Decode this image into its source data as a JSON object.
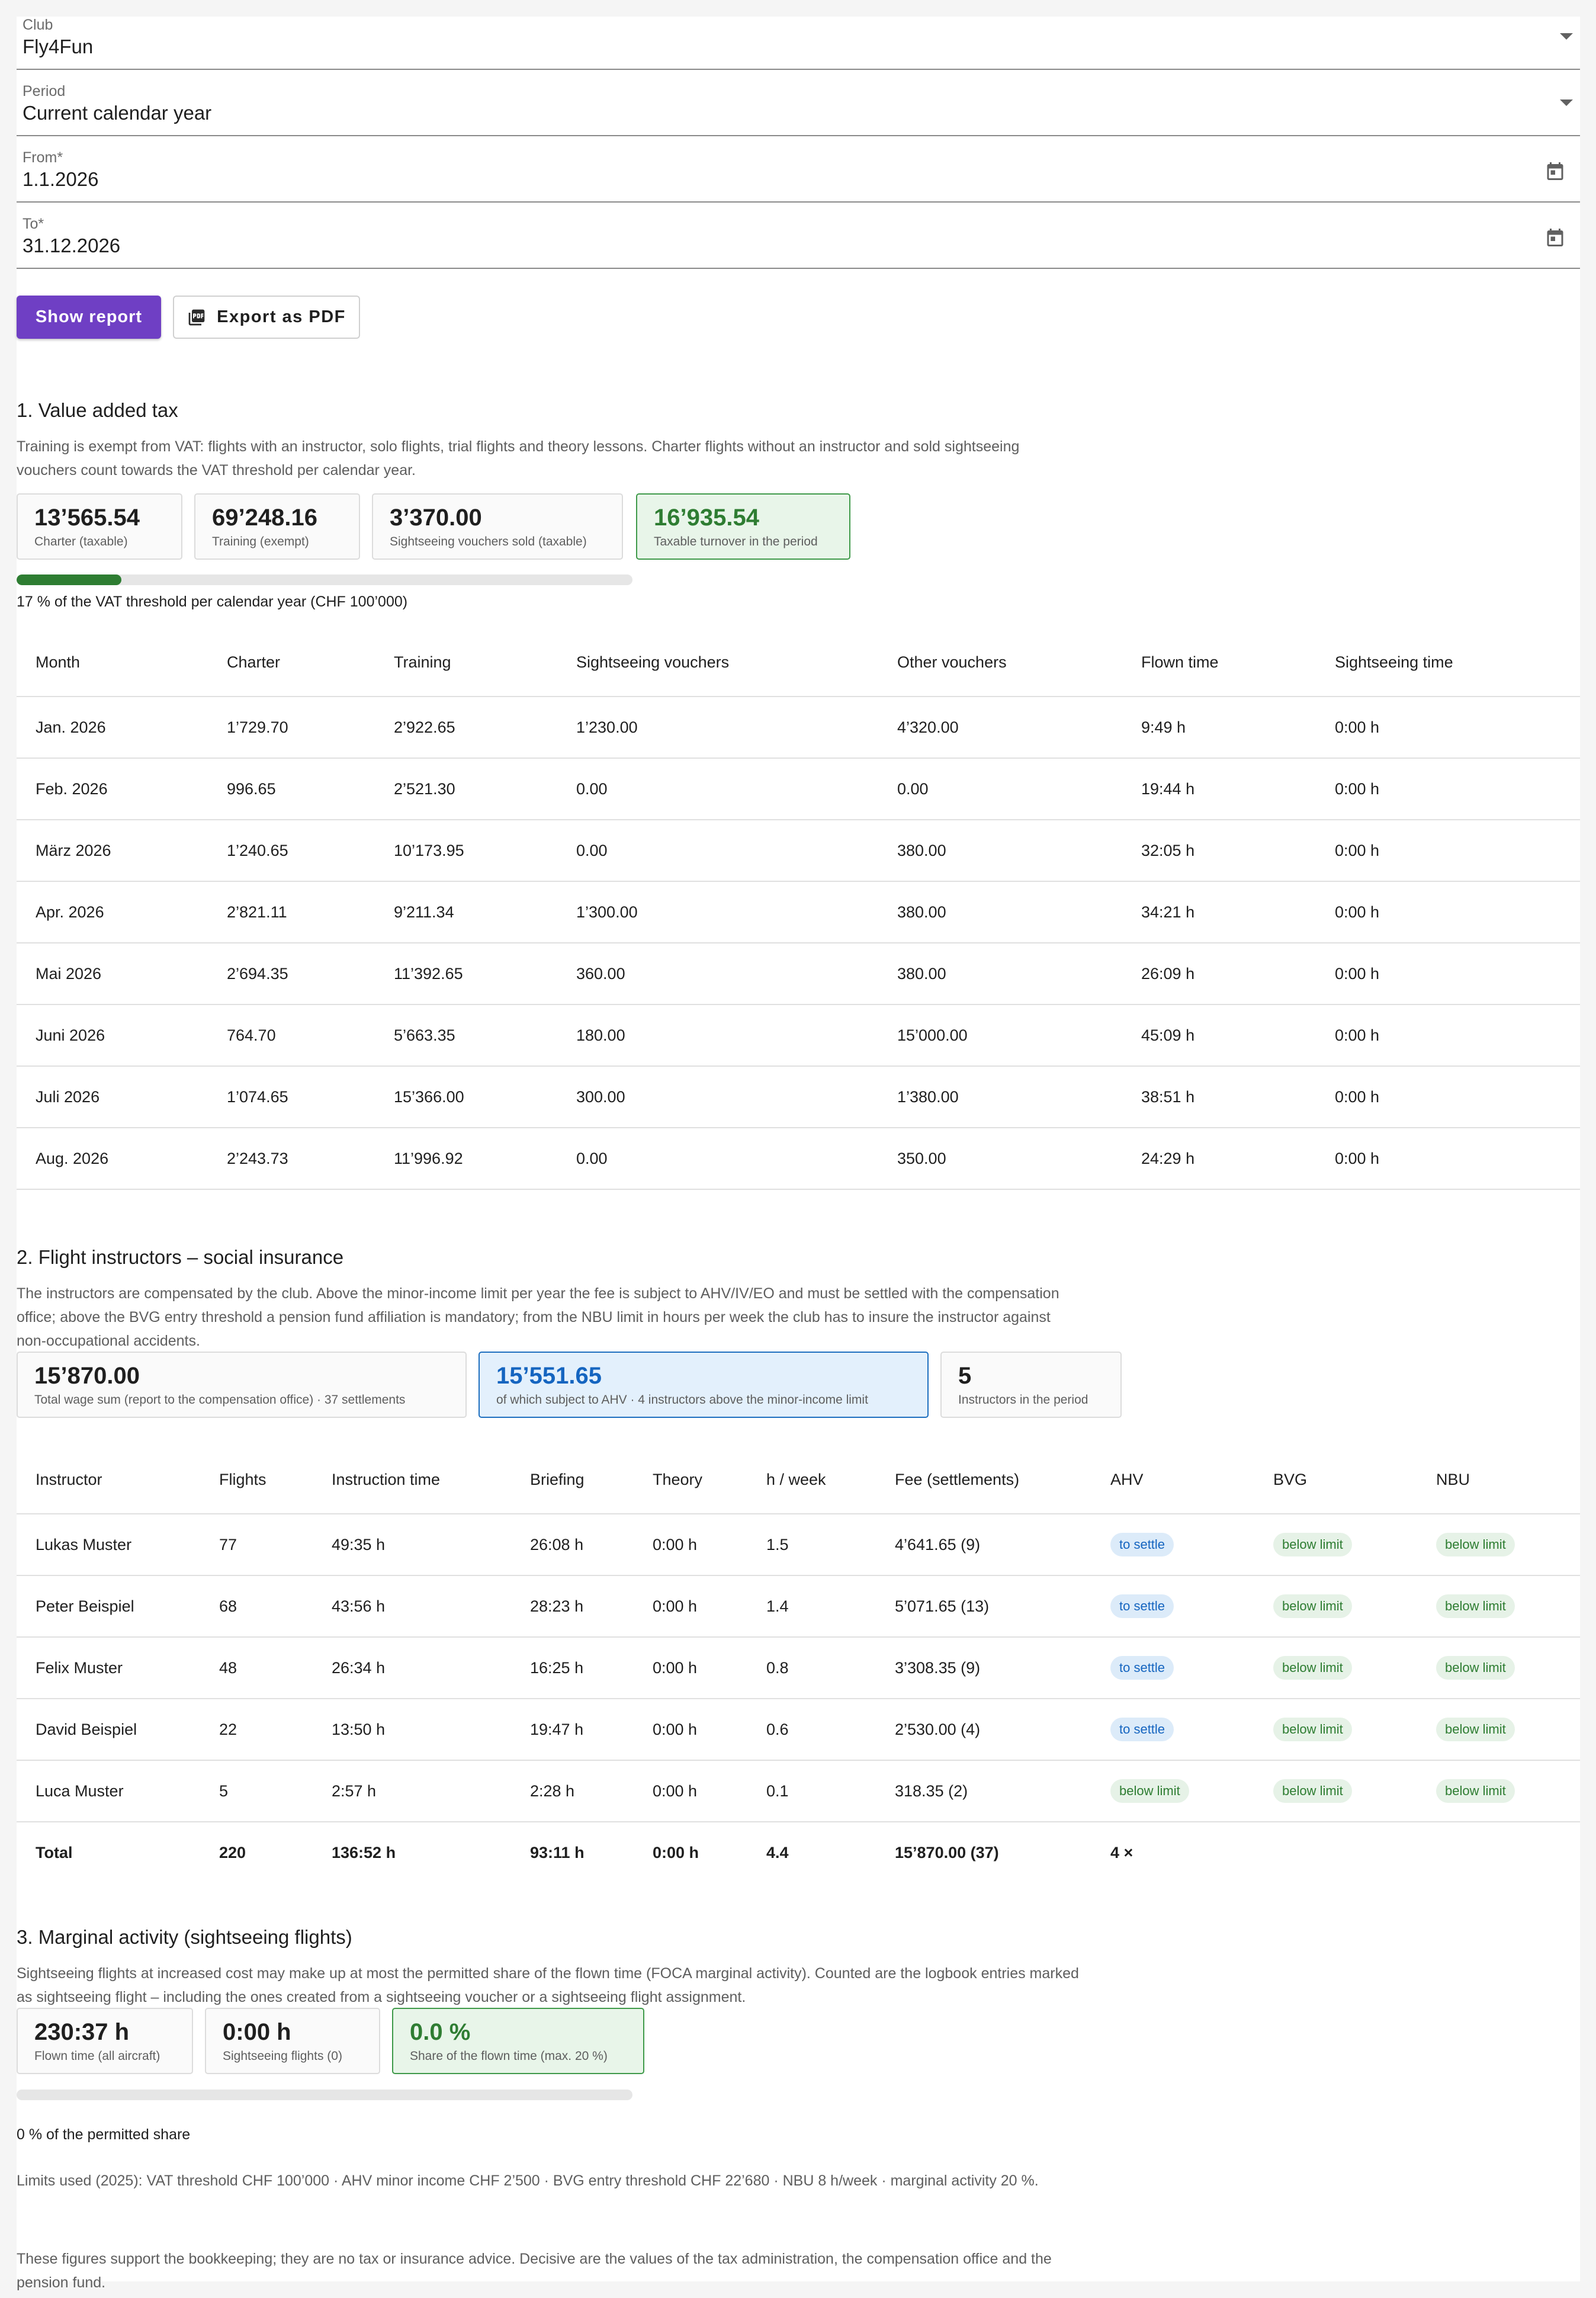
{
  "form": {
    "club": {
      "label": "Club",
      "value": "Fly4Fun"
    },
    "period": {
      "label": "Period",
      "value": "Current calendar year"
    },
    "from": {
      "label": "From*",
      "value": "1.1.2026"
    },
    "to": {
      "label": "To*",
      "value": "31.12.2026"
    },
    "show_report_label": "Show report",
    "export_pdf_label": "Export as PDF"
  },
  "vat": {
    "title": "1. Value added tax",
    "description": "Training is exempt from VAT: flights with an instructor, solo flights, trial flights and theory lessons. Charter flights without an instructor and sold sightseeing vouchers count towards the VAT threshold per calendar year.",
    "cards": [
      {
        "value": "13’565.54",
        "label": "Charter (taxable)"
      },
      {
        "value": "69’248.16",
        "label": "Training (exempt)"
      },
      {
        "value": "3’370.00",
        "label": "Sightseeing vouchers sold (taxable)"
      },
      {
        "value": "16’935.54",
        "label": "Taxable turnover in the period"
      }
    ],
    "progress_percent": 17,
    "progress_text": "17 % of the VAT threshold per calendar year (CHF 100’000)",
    "columns": [
      "Month",
      "Charter",
      "Training",
      "Sightseeing vouchers",
      "Other vouchers",
      "Flown time",
      "Sightseeing time"
    ],
    "rows": [
      [
        "Jan. 2026",
        "1’729.70",
        "2’922.65",
        "1’230.00",
        "4’320.00",
        "9:49 h",
        "0:00 h"
      ],
      [
        "Feb. 2026",
        "996.65",
        "2’521.30",
        "0.00",
        "0.00",
        "19:44 h",
        "0:00 h"
      ],
      [
        "März 2026",
        "1’240.65",
        "10’173.95",
        "0.00",
        "380.00",
        "32:05 h",
        "0:00 h"
      ],
      [
        "Apr. 2026",
        "2’821.11",
        "9’211.34",
        "1’300.00",
        "380.00",
        "34:21 h",
        "0:00 h"
      ],
      [
        "Mai 2026",
        "2’694.35",
        "11’392.65",
        "360.00",
        "380.00",
        "26:09 h",
        "0:00 h"
      ],
      [
        "Juni 2026",
        "764.70",
        "5’663.35",
        "180.00",
        "15’000.00",
        "45:09 h",
        "0:00 h"
      ],
      [
        "Juli 2026",
        "1’074.65",
        "15’366.00",
        "300.00",
        "1’380.00",
        "38:51 h",
        "0:00 h"
      ],
      [
        "Aug. 2026",
        "2’243.73",
        "11’996.92",
        "0.00",
        "350.00",
        "24:29 h",
        "0:00 h"
      ]
    ]
  },
  "instructors": {
    "title": "2. Flight instructors – social insurance",
    "description": "The instructors are compensated by the club. Above the minor-income limit per year the fee is subject to AHV/IV/EO and must be settled with the compensation office; above the BVG entry threshold a pension fund affiliation is mandatory; from the NBU limit in hours per week the club has to insure the instructor against non-occupational accidents.",
    "cards": [
      {
        "value": "15’870.00",
        "label": "Total wage sum (report to the compensation office) · 37 settlements"
      },
      {
        "value": "15’551.65",
        "label": "of which subject to AHV · 4 instructors above the minor-income limit"
      },
      {
        "value": "5",
        "label": "Instructors in the period"
      }
    ],
    "columns": [
      "Instructor",
      "Flights",
      "Instruction time",
      "Briefing",
      "Theory",
      "h / week",
      "Fee (settlements)",
      "AHV",
      "BVG",
      "NBU"
    ],
    "rows": [
      {
        "name": "Lukas Muster",
        "flights": "77",
        "instruction": "49:35 h",
        "briefing": "26:08 h",
        "theory": "0:00 h",
        "hweek": "1.5",
        "fee": "4’641.65 (9)",
        "ahv": "to settle",
        "bvg": "below limit",
        "nbu": "below limit"
      },
      {
        "name": "Peter Beispiel",
        "flights": "68",
        "instruction": "43:56 h",
        "briefing": "28:23 h",
        "theory": "0:00 h",
        "hweek": "1.4",
        "fee": "5’071.65 (13)",
        "ahv": "to settle",
        "bvg": "below limit",
        "nbu": "below limit"
      },
      {
        "name": "Felix Muster",
        "flights": "48",
        "instruction": "26:34 h",
        "briefing": "16:25 h",
        "theory": "0:00 h",
        "hweek": "0.8",
        "fee": "3’308.35 (9)",
        "ahv": "to settle",
        "bvg": "below limit",
        "nbu": "below limit"
      },
      {
        "name": "David Beispiel",
        "flights": "22",
        "instruction": "13:50 h",
        "briefing": "19:47 h",
        "theory": "0:00 h",
        "hweek": "0.6",
        "fee": "2’530.00 (4)",
        "ahv": "to settle",
        "bvg": "below limit",
        "nbu": "below limit"
      },
      {
        "name": "Luca Muster",
        "flights": "5",
        "instruction": "2:57 h",
        "briefing": "2:28 h",
        "theory": "0:00 h",
        "hweek": "0.1",
        "fee": "318.35 (2)",
        "ahv": "below limit",
        "bvg": "below limit",
        "nbu": "below limit"
      }
    ],
    "total": {
      "name": "Total",
      "flights": "220",
      "instruction": "136:52 h",
      "briefing": "93:11 h",
      "theory": "0:00 h",
      "hweek": "4.4",
      "fee": "15’870.00 (37)",
      "ahv": "4 ×"
    }
  },
  "marginal": {
    "title": "3. Marginal activity (sightseeing flights)",
    "description": "Sightseeing flights at increased cost may make up at most the permitted share of the flown time (FOCA marginal activity). Counted are the logbook entries marked as sightseeing flight – including the ones created from a sightseeing voucher or a sightseeing flight assignment.",
    "cards": [
      {
        "value": "230:37 h",
        "label": "Flown time (all aircraft)"
      },
      {
        "value": "0:00 h",
        "label": "Sightseeing flights (0)"
      },
      {
        "value": "0.0 %",
        "label": "Share of the flown time (max. 20 %)"
      }
    ],
    "progress_percent": 0,
    "progress_text": "0 % of the permitted share"
  },
  "footer": {
    "limits": "Limits used (2025): VAT threshold CHF 100’000 · AHV minor income CHF 2’500 · BVG entry threshold CHF 22’680 · NBU 8 h/week · marginal activity 20 %.",
    "disclaimer": "These figures support the bookkeeping; they are no tax or insurance advice. Decisive are the values of the tax administration, the compensation office and the pension fund."
  },
  "colors": {
    "primary": "#6f3fc4",
    "success": "#2e7d32",
    "info": "#1565c0"
  },
  "icons": {
    "dropdown": "chevron-down-icon",
    "date": "calendar-icon",
    "pdf": "pdf-icon"
  }
}
